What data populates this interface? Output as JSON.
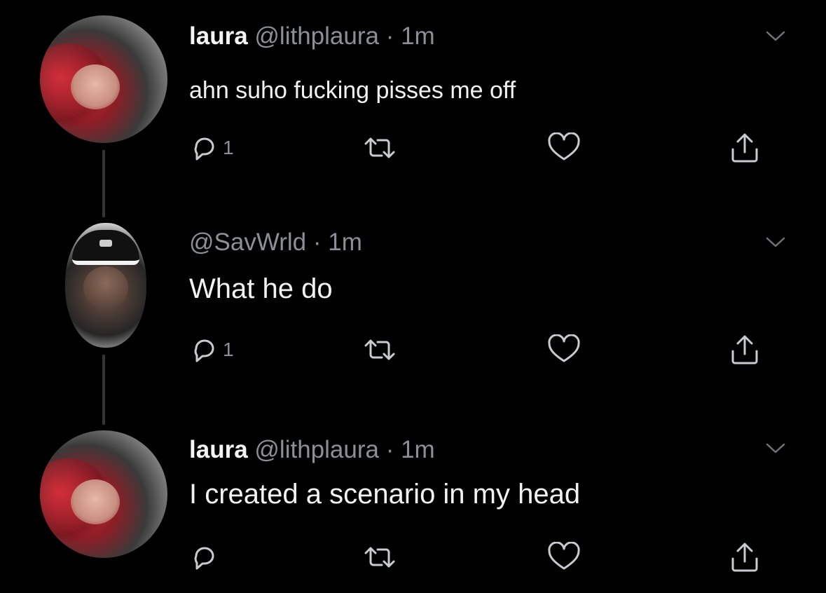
{
  "tweets": [
    {
      "name": "laura",
      "handle": "@lithplaura",
      "separator": "·",
      "time": "1m",
      "text": "ahn suho fucking pisses me off",
      "reply_count": "1"
    },
    {
      "name": "",
      "handle": "@SavWrld",
      "separator": "·",
      "time": "1m",
      "text": "What he do",
      "reply_count": "1"
    },
    {
      "name": "laura",
      "handle": "@lithplaura",
      "separator": "·",
      "time": "1m",
      "text": "I created a scenario in my head",
      "reply_count": ""
    }
  ],
  "icons": {
    "reply": "reply-icon",
    "retweet": "retweet-icon",
    "like": "heart-icon",
    "share": "share-icon",
    "menu": "chevron-down-icon"
  },
  "colors": {
    "background": "#000000",
    "text": "#f2f2f2",
    "muted": "#8b9096",
    "icon": "#c8ccd0",
    "thread_line": "#333639"
  }
}
